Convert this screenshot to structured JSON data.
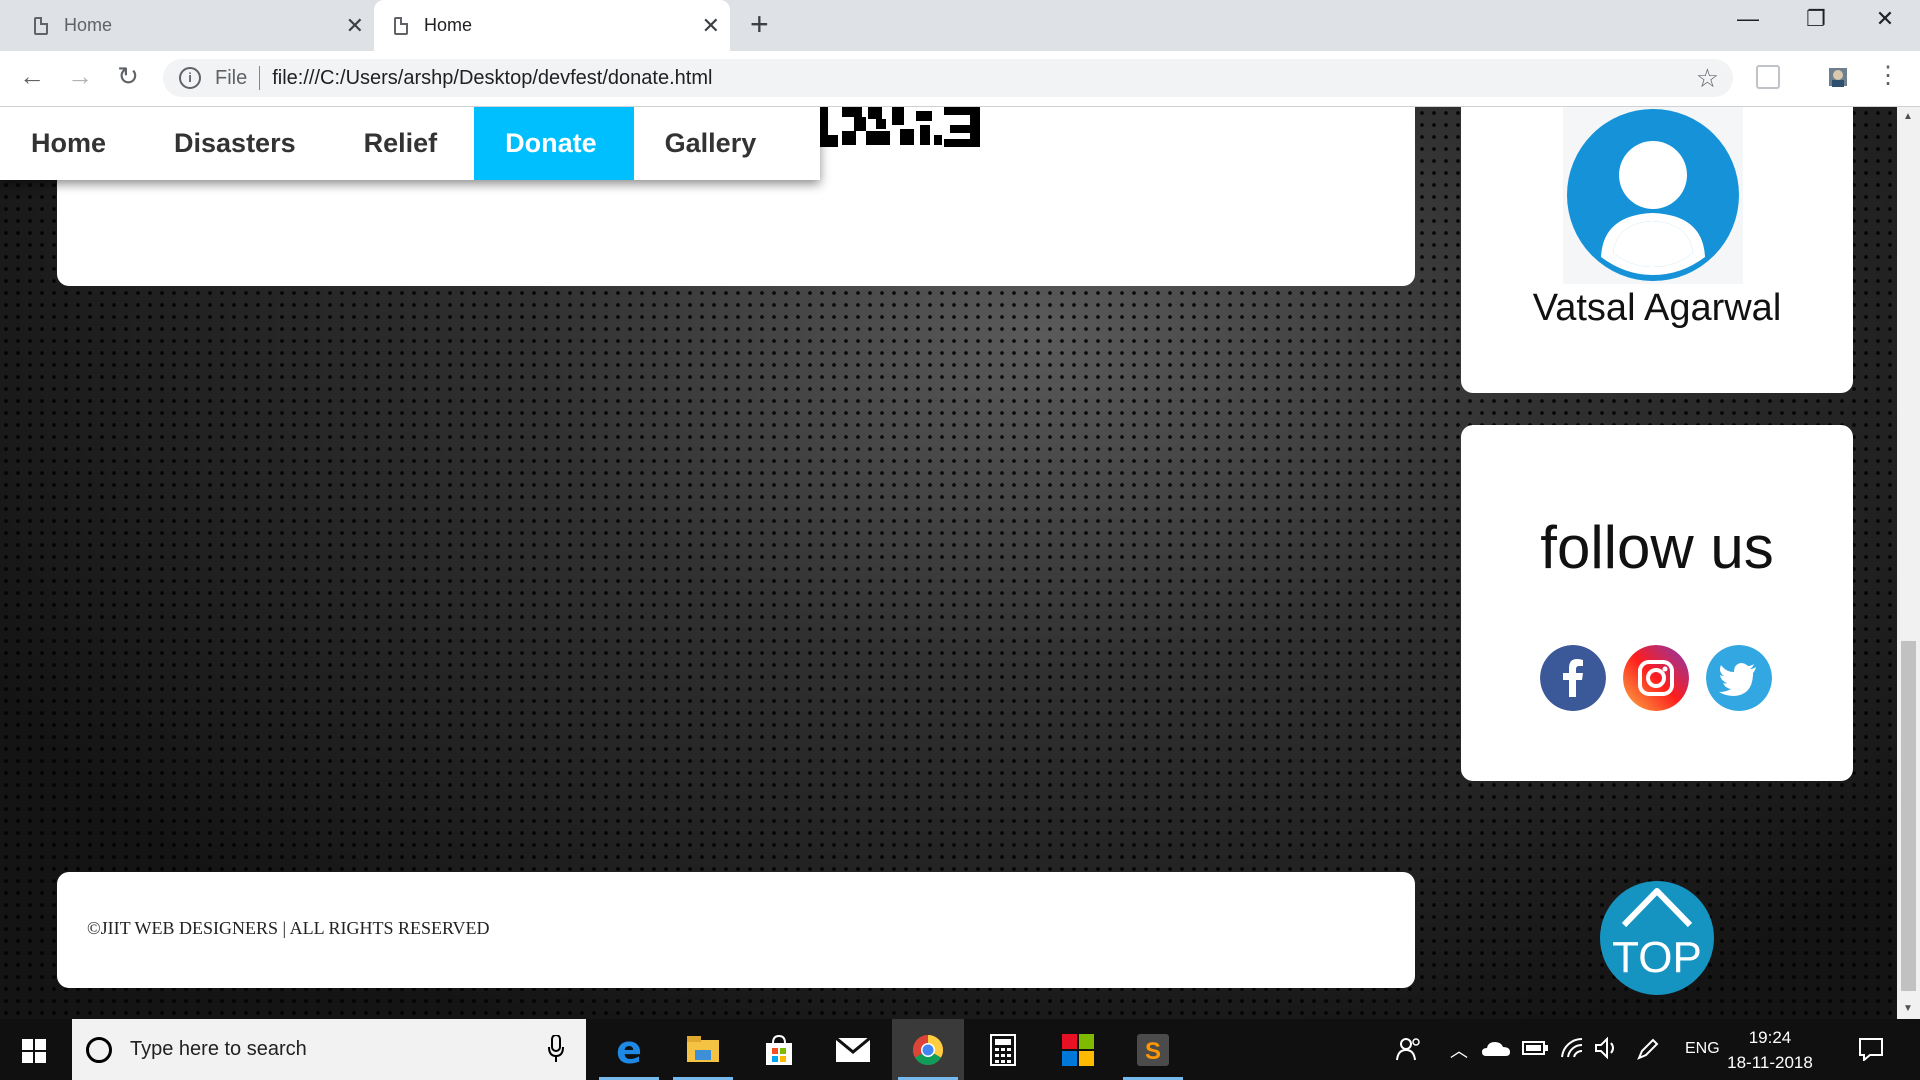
{
  "browser": {
    "tabs": [
      {
        "title": "Home",
        "active": false
      },
      {
        "title": "Home",
        "active": true
      }
    ],
    "new_tab": "+",
    "window_controls": {
      "minimize": "—",
      "restore": "❐",
      "close": "✕"
    },
    "toolbar": {
      "back": "←",
      "forward": "→",
      "reload": "↻"
    },
    "address": {
      "scheme": "File",
      "url": "file:///C:/Users/arshp/Desktop/devfest/donate.html"
    }
  },
  "site": {
    "nav": [
      {
        "label": "Home",
        "active": false
      },
      {
        "label": "Disasters",
        "active": false
      },
      {
        "label": "Relief",
        "active": false
      },
      {
        "label": "Donate",
        "active": true
      },
      {
        "label": "Gallery",
        "active": false
      }
    ],
    "nav_active_color": "#00bfff",
    "profile": {
      "name": "Vatsal Agarwal",
      "avatar_color": "#1592d8"
    },
    "follow": {
      "title": "follow us",
      "icons": [
        "facebook-icon",
        "instagram-icon",
        "twitter-icon"
      ]
    },
    "footer": {
      "text": "©JIIT WEB DESIGNERS | ALL RIGHTS RESERVED"
    },
    "top_button": {
      "label": "TOP",
      "color": "#1593c1"
    }
  },
  "taskbar": {
    "search_placeholder": "Type here to search",
    "apps": [
      "edge-icon",
      "file-explorer-icon",
      "store-icon",
      "mail-icon",
      "chrome-icon",
      "calculator-icon",
      "office-icon",
      "sublime-text-icon"
    ],
    "language": "ENG",
    "time": "19:24",
    "date": "18-11-2018"
  }
}
